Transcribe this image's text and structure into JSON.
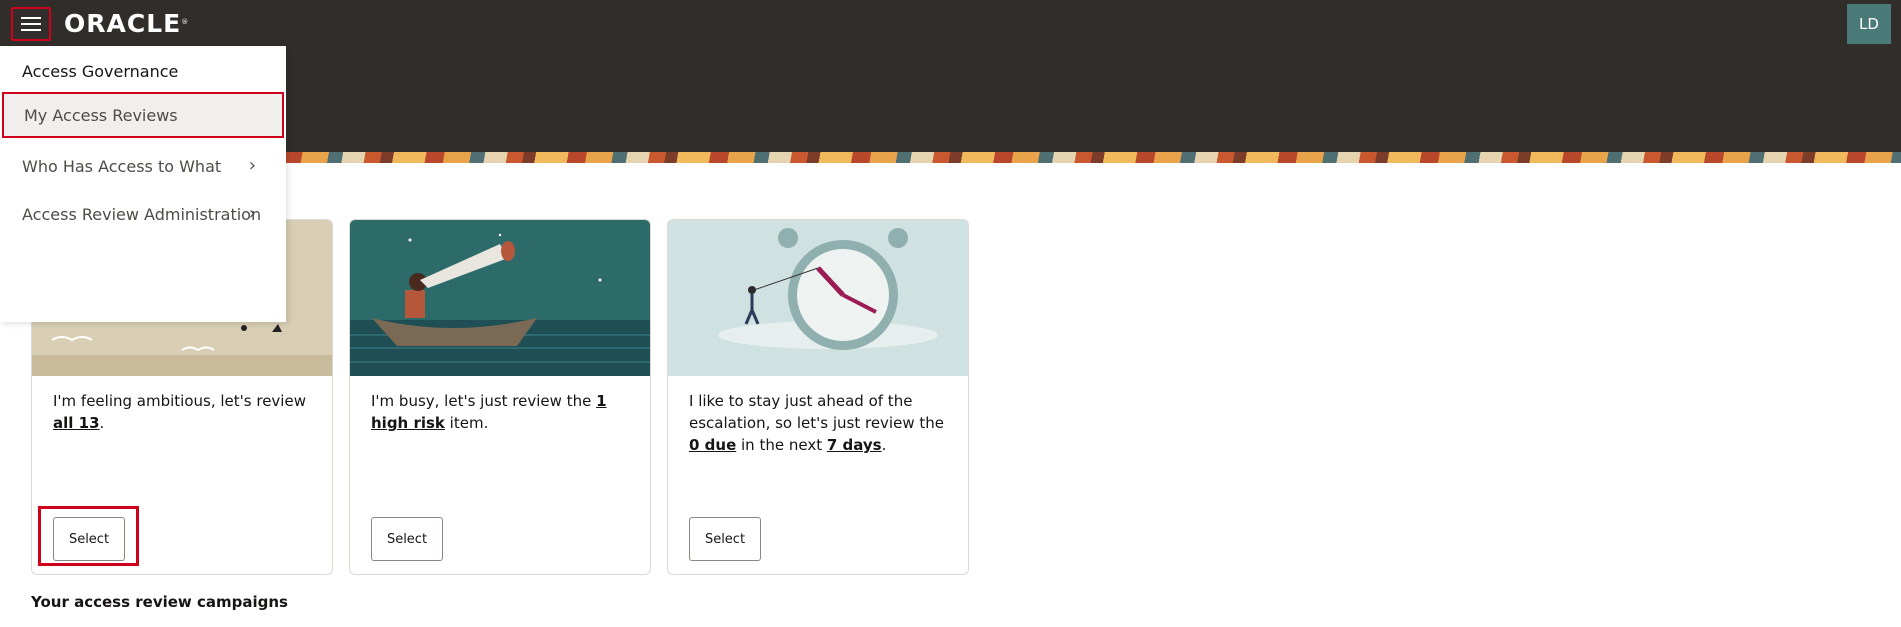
{
  "header": {
    "logo": "ORACLE",
    "logo_mark": "®",
    "avatar_initials": "LD"
  },
  "menu": {
    "heading": "Access Governance",
    "items": [
      {
        "label": "My Access Reviews",
        "selected": true
      },
      {
        "label": "Who Has Access to What",
        "has_submenu": true
      },
      {
        "label": "Access Review Administration",
        "has_submenu": true
      }
    ]
  },
  "cards": [
    {
      "text_before": "I'm feeling ambitious, let's review ",
      "link1": "all 13",
      "text_after": ".",
      "button": "Select"
    },
    {
      "text_before": "I'm busy, let's just review the ",
      "link1": "1 high risk",
      "text_after": " item.",
      "button": "Select"
    },
    {
      "text_before": "I like to stay just ahead of the escalation, so let's just review the ",
      "link1": "0 due",
      "text_middle": " in the next ",
      "link2": "7 days",
      "text_after": ".",
      "button": "Select"
    }
  ],
  "section": {
    "title": "Your access review campaigns"
  },
  "colors": {
    "header_bg": "#312d2a",
    "highlight": "#d0021b",
    "avatar_bg": "#4a7a78"
  }
}
